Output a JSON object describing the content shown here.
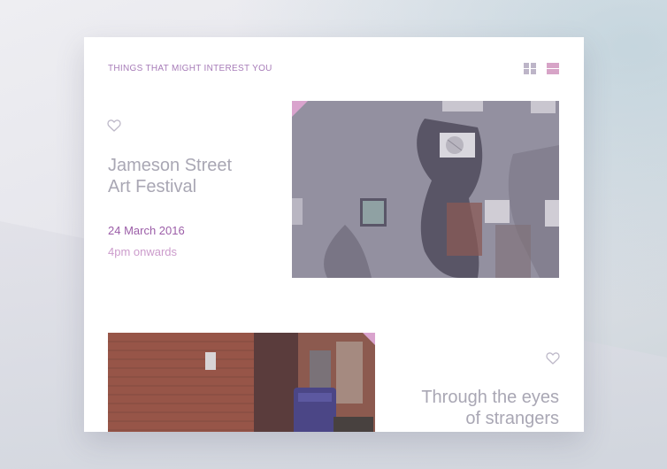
{
  "section": {
    "title": "THINGS THAT MIGHT INTEREST YOU"
  },
  "view_toggle": {
    "active": "list",
    "icons": [
      "grid-view-icon",
      "list-view-icon"
    ]
  },
  "events": [
    {
      "title_line1": "Jameson Street",
      "title_line2": "Art Festival",
      "date": "24 March 2016",
      "time": "4pm onwards",
      "favorite_icon": "heart-outline-icon",
      "image": "weathered concrete building wall with air-conditioner"
    },
    {
      "title_line1": "Through the eyes",
      "title_line2": "of strangers",
      "favorite_icon": "heart-outline-icon",
      "image": "red brick alley with dumpster"
    }
  ],
  "colors": {
    "accent": "#9c5ea8",
    "accent_light": "#cc9ccc",
    "title_text": "#a9a7b4",
    "tag": "#d9a3cd"
  }
}
